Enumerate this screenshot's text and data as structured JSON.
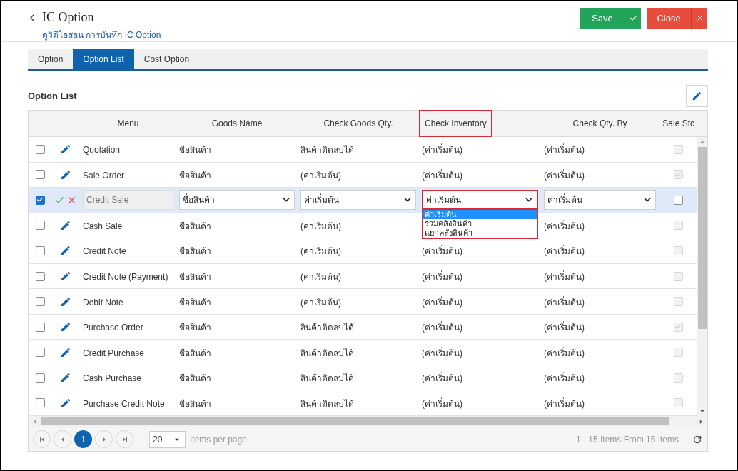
{
  "header": {
    "title": "IC Option",
    "subtitle": "ดูวิดีโอสอน การบันทึก IC Option",
    "save_label": "Save",
    "close_label": "Close"
  },
  "tabs": [
    {
      "label": "Option",
      "selected": false
    },
    {
      "label": "Option List",
      "selected": true
    },
    {
      "label": "Cost Option",
      "selected": false
    }
  ],
  "section_title": "Option List",
  "table": {
    "columns": [
      {
        "label": "Menu",
        "highlighted": false
      },
      {
        "label": "Goods Name",
        "highlighted": false
      },
      {
        "label": "Check Goods Qty.",
        "highlighted": false
      },
      {
        "label": "Check Inventory",
        "highlighted": true
      },
      {
        "label": "Check Qty. By",
        "highlighted": false
      },
      {
        "label": "Sale Stc",
        "highlighted": false
      }
    ],
    "rows": [
      {
        "kind": "view",
        "selected": false,
        "menu": "Quotation",
        "goods_name": "ชื่อสินค้า",
        "check_goods_qty": "สินค้าติดลบได้",
        "check_inventory": "(ค่าเริ่มต้น)",
        "check_qty_by": "(ค่าเริ่มต้น)",
        "sale_stock": {
          "checked": false,
          "disabled": true
        }
      },
      {
        "kind": "view",
        "selected": false,
        "menu": "Sale Order",
        "goods_name": "ชื่อสินค้า",
        "check_goods_qty": "(ค่าเริ่มต้น)",
        "check_inventory": "(ค่าเริ่มต้น)",
        "check_qty_by": "(ค่าเริ่มต้น)",
        "sale_stock": {
          "checked": true,
          "disabled": true
        }
      },
      {
        "kind": "edit",
        "selected": true,
        "menu": "Credit Sale",
        "goods_name": "ชื่อสินค้า",
        "check_goods_qty": "ค่าเริ่มต้น",
        "check_inventory": "ค่าเริ่มต้น",
        "check_qty_by": "ค่าเริ่มต้น",
        "sale_stock": {
          "checked": false,
          "disabled": false
        },
        "open_dropdown": {
          "highlighted": true,
          "options": [
            {
              "label": "ค่าเริ่มต้น",
              "selected": true
            },
            {
              "label": "รวมคลังสินค้า",
              "selected": false
            },
            {
              "label": "แยกคลังสินค้า",
              "selected": false
            }
          ]
        }
      },
      {
        "kind": "view",
        "selected": false,
        "menu": "Cash Sale",
        "goods_name": "ชื่อสินค้า",
        "check_goods_qty": "(ค่าเริ่มต้น)",
        "check_qty_by": "(ค่าเริ่มต้น)",
        "sale_stock": {
          "checked": false,
          "disabled": true
        }
      },
      {
        "kind": "view",
        "selected": false,
        "menu": "Credit Note",
        "goods_name": "ชื่อสินค้า",
        "check_goods_qty": "(ค่าเริ่มต้น)",
        "check_inventory": "(ค่าเริ่มต้น)",
        "check_qty_by": "(ค่าเริ่มต้น)",
        "sale_stock": {
          "checked": false,
          "disabled": true
        }
      },
      {
        "kind": "view",
        "selected": false,
        "menu": "Credit Note (Payment)",
        "goods_name": "ชื่อสินค้า",
        "check_goods_qty": "(ค่าเริ่มต้น)",
        "check_inventory": "(ค่าเริ่มต้น)",
        "check_qty_by": "(ค่าเริ่มต้น)",
        "sale_stock": {
          "checked": false,
          "disabled": true
        }
      },
      {
        "kind": "view",
        "selected": false,
        "menu": "Debit Note",
        "goods_name": "ชื่อสินค้า",
        "check_goods_qty": "(ค่าเริ่มต้น)",
        "check_inventory": "(ค่าเริ่มต้น)",
        "check_qty_by": "(ค่าเริ่มต้น)",
        "sale_stock": {
          "checked": false,
          "disabled": true
        }
      },
      {
        "kind": "view",
        "selected": false,
        "menu": "Purchase Order",
        "goods_name": "ชื่อสินค้า",
        "check_goods_qty": "สินค้าติดลบได้",
        "check_inventory": "(ค่าเริ่มต้น)",
        "check_qty_by": "(ค่าเริ่มต้น)",
        "sale_stock": {
          "checked": true,
          "disabled": true
        }
      },
      {
        "kind": "view",
        "selected": false,
        "menu": "Credit Purchase",
        "goods_name": "ชื่อสินค้า",
        "check_goods_qty": "สินค้าติดลบได้",
        "check_inventory": "(ค่าเริ่มต้น)",
        "check_qty_by": "(ค่าเริ่มต้น)",
        "sale_stock": {
          "checked": false,
          "disabled": true
        }
      },
      {
        "kind": "view",
        "selected": false,
        "menu": "Cash Purchase",
        "goods_name": "ชื่อสินค้า",
        "check_goods_qty": "สินค้าติดลบได้",
        "check_inventory": "(ค่าเริ่มต้น)",
        "check_qty_by": "(ค่าเริ่มต้น)",
        "sale_stock": {
          "checked": false,
          "disabled": true
        }
      },
      {
        "kind": "view",
        "selected": false,
        "menu": "Purchase Credit Note",
        "goods_name": "ชื่อสินค้า",
        "check_goods_qty": "สินค้าติดลบได้",
        "check_inventory": "(ค่าเริ่มต้น)",
        "check_qty_by": "(ค่าเริ่มต้น)",
        "sale_stock": {
          "checked": false,
          "disabled": true
        }
      }
    ]
  },
  "pager": {
    "pages": [
      {
        "label": "1",
        "selected": true
      }
    ],
    "page_size": "20",
    "per_page_label": "Items per page",
    "summary": "1 - 15 Items From 15 Items"
  }
}
